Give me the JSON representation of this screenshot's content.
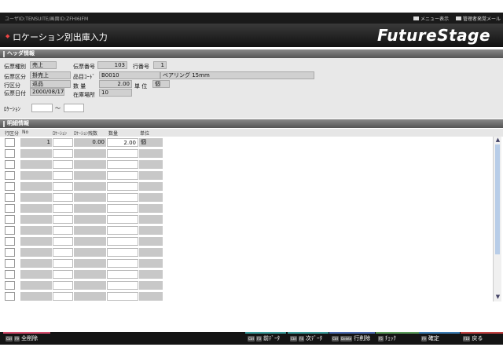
{
  "topbar": {
    "user": "ユーザID:TENSUITE/画面ID:ZFHI6IFM",
    "menu": "メニュー表示",
    "admin": "管理者発覚メール"
  },
  "header": {
    "title": "ロケーション別出庫入力",
    "logo": "FutureStage"
  },
  "header_section": {
    "title": "ヘッダ情報"
  },
  "form": {
    "denpyo_type_label": "伝票種別",
    "denpyo_type": "売上",
    "denpyo_no_label": "伝票番号",
    "denpyo_no": "103",
    "line_no_label": "行番号",
    "line_no": "1",
    "denpyo_kubun_label": "伝票区分",
    "denpyo_kubun": "掛売上",
    "item_code_label": "品目ｺｰﾄﾞ",
    "item_code": "B0010",
    "item_name": "ベアリング 15mm",
    "line_kubun_label": "行区分",
    "line_kubun": "返品",
    "quantity_label": "数 量",
    "quantity": "2.00",
    "unit_label": "単 位",
    "unit": "個",
    "denpyo_date_label": "伝票日付",
    "denpyo_date": "2000/08/17",
    "warehouse_label": "在庫場所",
    "warehouse": "10",
    "location_label": "ﾛｹｰｼｮﾝ",
    "location_sep": "～"
  },
  "detail_section": {
    "title": "明細情報"
  },
  "grid": {
    "headers": [
      "行区分",
      "No",
      "ﾛｹｰｼｮﾝ",
      "ﾛｹｰｼｮﾝ残数",
      "数量",
      "単位"
    ],
    "rows": [
      {
        "no": "1",
        "loc": "",
        "locq": "0.00",
        "qty": "2.00",
        "unit": "個"
      },
      {
        "no": "",
        "loc": "",
        "locq": "",
        "qty": "",
        "unit": ""
      },
      {
        "no": "",
        "loc": "",
        "locq": "",
        "qty": "",
        "unit": ""
      },
      {
        "no": "",
        "loc": "",
        "locq": "",
        "qty": "",
        "unit": ""
      },
      {
        "no": "",
        "loc": "",
        "locq": "",
        "qty": "",
        "unit": ""
      },
      {
        "no": "",
        "loc": "",
        "locq": "",
        "qty": "",
        "unit": ""
      },
      {
        "no": "",
        "loc": "",
        "locq": "",
        "qty": "",
        "unit": ""
      },
      {
        "no": "",
        "loc": "",
        "locq": "",
        "qty": "",
        "unit": ""
      },
      {
        "no": "",
        "loc": "",
        "locq": "",
        "qty": "",
        "unit": ""
      },
      {
        "no": "",
        "loc": "",
        "locq": "",
        "qty": "",
        "unit": ""
      },
      {
        "no": "",
        "loc": "",
        "locq": "",
        "qty": "",
        "unit": ""
      },
      {
        "no": "",
        "loc": "",
        "locq": "",
        "qty": "",
        "unit": ""
      },
      {
        "no": "",
        "loc": "",
        "locq": "",
        "qty": "",
        "unit": ""
      },
      {
        "no": "",
        "loc": "",
        "locq": "",
        "qty": "",
        "unit": ""
      },
      {
        "no": "",
        "loc": "",
        "locq": "",
        "qty": "",
        "unit": ""
      }
    ]
  },
  "footer": {
    "keys": [
      {
        "cap1": "Ctrl",
        "cap2": "F9",
        "label": "全削除",
        "color": "#d04a6a"
      },
      {
        "cap1": "Ctrl",
        "cap2": "F3",
        "label": "前ﾃﾞｰﾀ",
        "color": "#3a9a9a"
      },
      {
        "cap1": "Ctrl",
        "cap2": "F4",
        "label": "次ﾃﾞｰﾀ",
        "color": "#3a9a9a"
      },
      {
        "cap1": "Ctrl",
        "cap2": "Delete",
        "label": "行削除",
        "color": "#4a6ab0"
      },
      {
        "cap1": "F5",
        "cap2": "",
        "label": "ﾁｪｯｸ",
        "color": "#5a9a5a"
      },
      {
        "cap1": "F9",
        "cap2": "",
        "label": "確定",
        "color": "#3a7ab0"
      },
      {
        "cap1": "F10",
        "cap2": "",
        "label": "戻る",
        "color": "#c04040"
      }
    ]
  }
}
